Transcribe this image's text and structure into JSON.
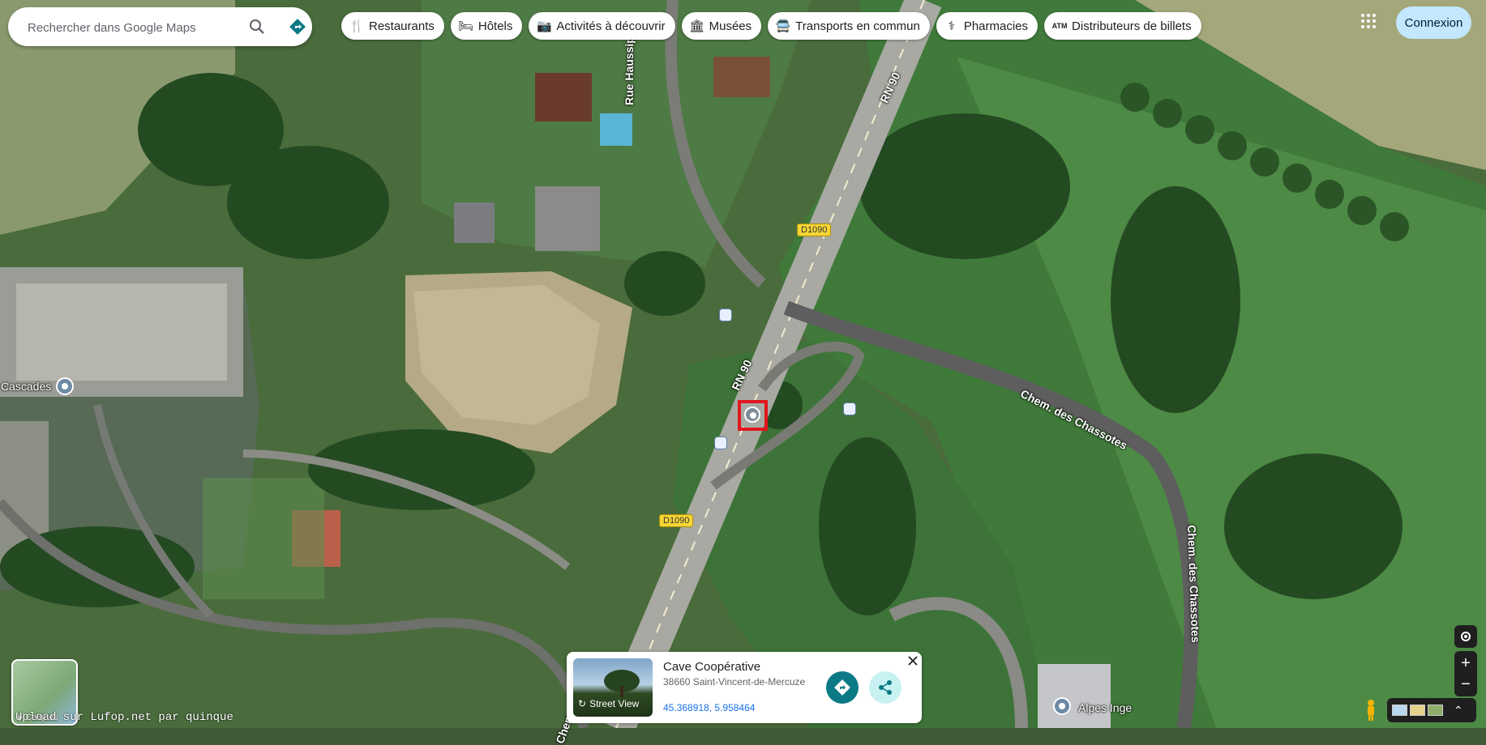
{
  "search": {
    "placeholder": "Rechercher dans Google Maps"
  },
  "categories": [
    {
      "label": "Restaurants",
      "icon": "fork-knife-icon"
    },
    {
      "label": "Hôtels",
      "icon": "bed-icon"
    },
    {
      "label": "Activités à découvrir",
      "icon": "camera-icon"
    },
    {
      "label": "Musées",
      "icon": "museum-icon"
    },
    {
      "label": "Transports en commun",
      "icon": "transit-icon"
    },
    {
      "label": "Pharmacies",
      "icon": "pharmacy-icon"
    },
    {
      "label": "Distributeurs de billets",
      "icon": "atm-icon"
    }
  ],
  "header": {
    "login_label": "Connexion"
  },
  "map_labels": {
    "rue_haussipied": "Rue Haussipied",
    "rn90_top": "RN 90",
    "rn90_mid": "RN 90",
    "d1090_top": "D1090",
    "d1090_bottom": "D1090",
    "chem_chassotes_1": "Chem. des Chassotes",
    "chem_chassotes_2": "Chem. des Chassotes",
    "bottom_road": "Chem. de la M..."
  },
  "pois": {
    "cascades": "Cascades",
    "alpes_inge": "Alpes Inge"
  },
  "place_card": {
    "title": "Cave Coopérative",
    "address": "38660 Saint-Vincent-de-Mercuze",
    "coordinates": "45.368918, 5.958464",
    "street_view_label": "Street View"
  },
  "layers": {
    "label": "Calques"
  },
  "footer": {
    "upload_text": "Upload sur Lufop.net par quinque"
  },
  "colors": {
    "accent": "#0b7a86",
    "marker": "#e0161e",
    "login_bg": "#c2e7ff"
  }
}
